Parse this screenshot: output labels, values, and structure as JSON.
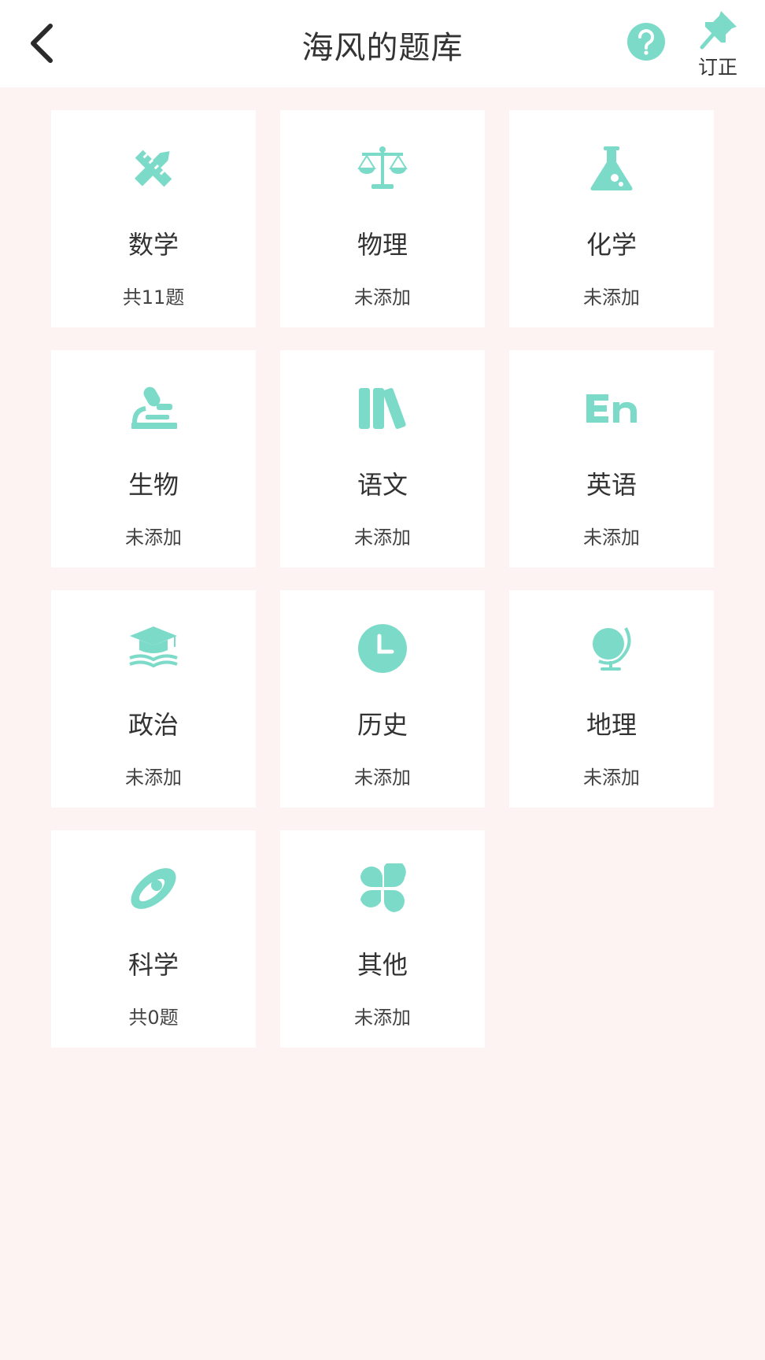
{
  "header": {
    "title": "海风的题库",
    "back_icon": "back-chevron-icon",
    "help_icon": "question-circle-icon",
    "fix_icon": "pushpin-icon",
    "fix_label": "订正"
  },
  "colors": {
    "accent": "#7cdac8",
    "background": "#fdf3f2",
    "card": "#ffffff",
    "text": "#333333"
  },
  "subjects": [
    {
      "name": "数学",
      "count": "共11题",
      "icon": "pencil-ruler-icon"
    },
    {
      "name": "物理",
      "count": "未添加",
      "icon": "balance-scale-icon"
    },
    {
      "name": "化学",
      "count": "未添加",
      "icon": "flask-icon"
    },
    {
      "name": "生物",
      "count": "未添加",
      "icon": "microscope-icon"
    },
    {
      "name": "语文",
      "count": "未添加",
      "icon": "books-icon"
    },
    {
      "name": "英语",
      "count": "未添加",
      "icon": "en-letters-icon"
    },
    {
      "name": "政治",
      "count": "未添加",
      "icon": "graduation-cap-book-icon"
    },
    {
      "name": "历史",
      "count": "未添加",
      "icon": "clock-icon"
    },
    {
      "name": "地理",
      "count": "未添加",
      "icon": "globe-icon"
    },
    {
      "name": "科学",
      "count": "共0题",
      "icon": "atom-orbit-icon"
    },
    {
      "name": "其他",
      "count": "未添加",
      "icon": "four-leaf-grid-icon"
    }
  ]
}
